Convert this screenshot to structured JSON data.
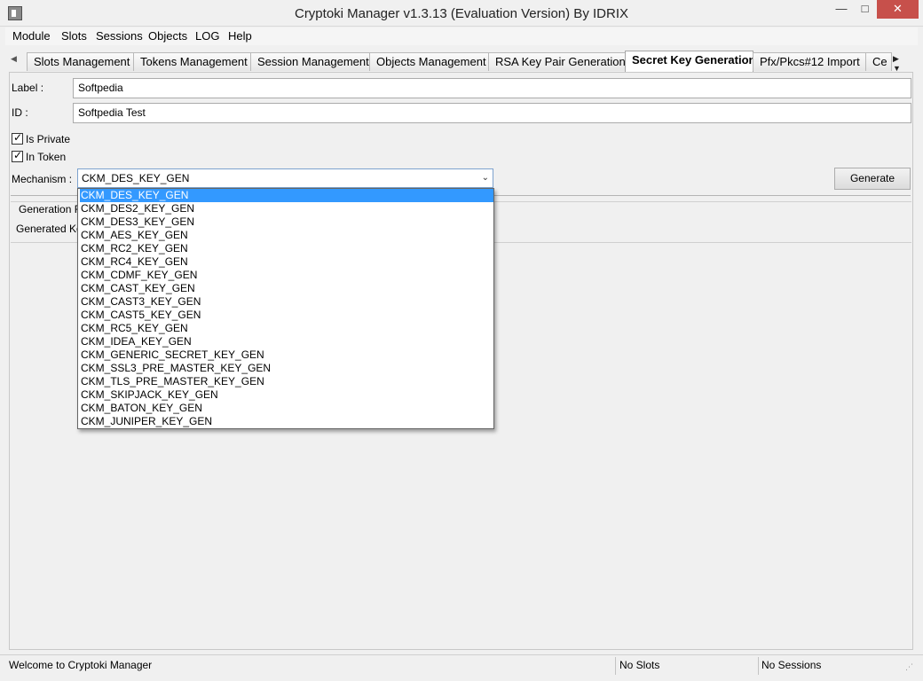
{
  "window": {
    "title": "Cryptoki Manager v1.3.13  (Evaluation Version)  By IDRIX",
    "minimize": "—",
    "maximize": "□",
    "close": "✕"
  },
  "menu": [
    "Module",
    "Slots",
    "Sessions",
    "Objects",
    "LOG",
    "Help"
  ],
  "tabs": [
    "Slots Management",
    "Tokens Management",
    "Session Management",
    "Objects Management",
    "RSA Key Pair Generation",
    "Secret Key Generation",
    "Pfx/Pkcs#12 Import",
    "Ce"
  ],
  "active_tab": "Secret Key Generation",
  "tab_arrows": "▶ ▼",
  "form": {
    "label_caption": "Label :",
    "label_value": "Softpedia",
    "id_caption": "ID :",
    "id_value": "Softpedia Test",
    "is_private_label": "Is Private",
    "is_private_checked": true,
    "in_token_label": "In Token",
    "in_token_checked": true,
    "mechanism_caption": "Mechanism :",
    "mechanism_value": "CKM_DES_KEY_GEN",
    "generate_button": "Generate",
    "generation_result_partial": "Generation R",
    "generated_key_partial": "Generated Ke"
  },
  "mechanism_options": [
    "CKM_DES_KEY_GEN",
    "CKM_DES2_KEY_GEN",
    "CKM_DES3_KEY_GEN",
    "CKM_AES_KEY_GEN",
    "CKM_RC2_KEY_GEN",
    "CKM_RC4_KEY_GEN",
    "CKM_CDMF_KEY_GEN",
    "CKM_CAST_KEY_GEN",
    "CKM_CAST3_KEY_GEN",
    "CKM_CAST5_KEY_GEN",
    "CKM_RC5_KEY_GEN",
    "CKM_IDEA_KEY_GEN",
    "CKM_GENERIC_SECRET_KEY_GEN",
    "CKM_SSL3_PRE_MASTER_KEY_GEN",
    "CKM_TLS_PRE_MASTER_KEY_GEN",
    "CKM_SKIPJACK_KEY_GEN",
    "CKM_BATON_KEY_GEN",
    "CKM_JUNIPER_KEY_GEN"
  ],
  "selected_option_index": 0,
  "status": {
    "message": "Welcome to Cryptoki Manager",
    "slots": "No Slots",
    "sessions": "No Sessions"
  },
  "colors": {
    "selection": "#3399ff",
    "close_button": "#c7504b"
  }
}
